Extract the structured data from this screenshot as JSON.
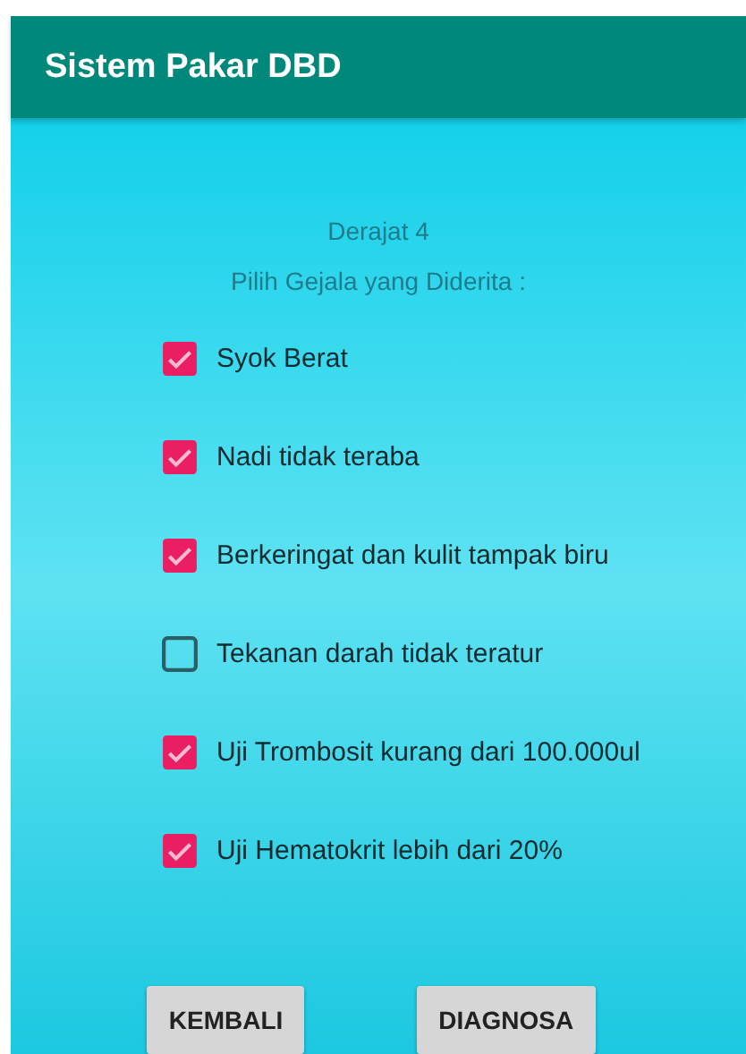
{
  "app_bar": {
    "title": "Sistem Pakar DBD"
  },
  "heading": "Derajat 4",
  "prompt": "Pilih Gejala yang Diderita :",
  "symptoms": [
    {
      "label": "Syok Berat",
      "checked": true
    },
    {
      "label": "Nadi tidak teraba",
      "checked": true
    },
    {
      "label": "Berkeringat dan kulit tampak biru",
      "checked": true
    },
    {
      "label": "Tekanan darah tidak teratur",
      "checked": false
    },
    {
      "label": "Uji Trombosit kurang dari 100.000ul",
      "checked": true
    },
    {
      "label": "Uji Hematokrit lebih dari 20%",
      "checked": true
    }
  ],
  "buttons": [
    "KEMBALI",
    "DIAGNOSA"
  ]
}
